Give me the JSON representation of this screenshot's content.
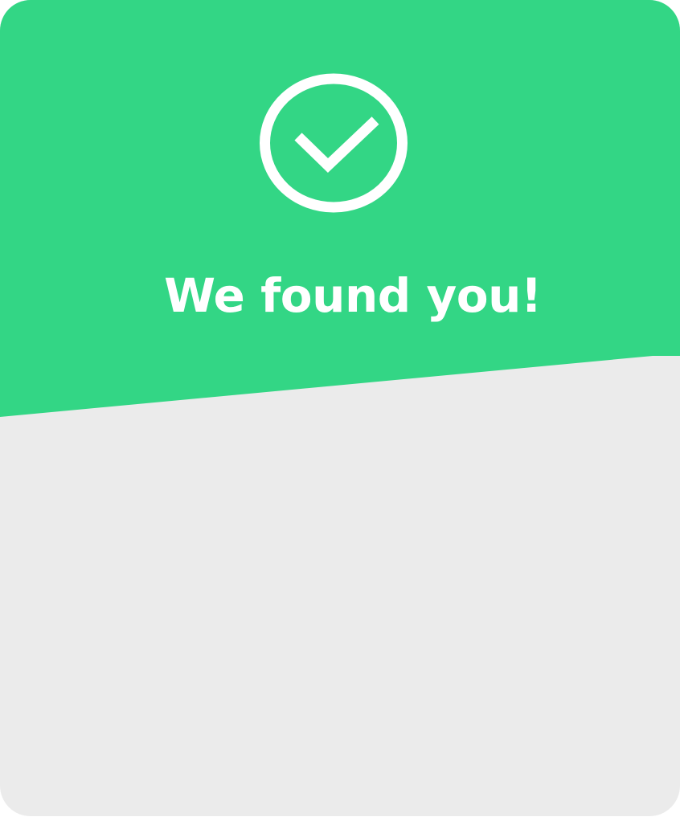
{
  "success_card": {
    "title": "We found you!",
    "status_icon": "check-circle-icon",
    "colors": {
      "accent": "#33d685",
      "panel": "#ebebeb",
      "foreground": "#ffffff"
    }
  }
}
